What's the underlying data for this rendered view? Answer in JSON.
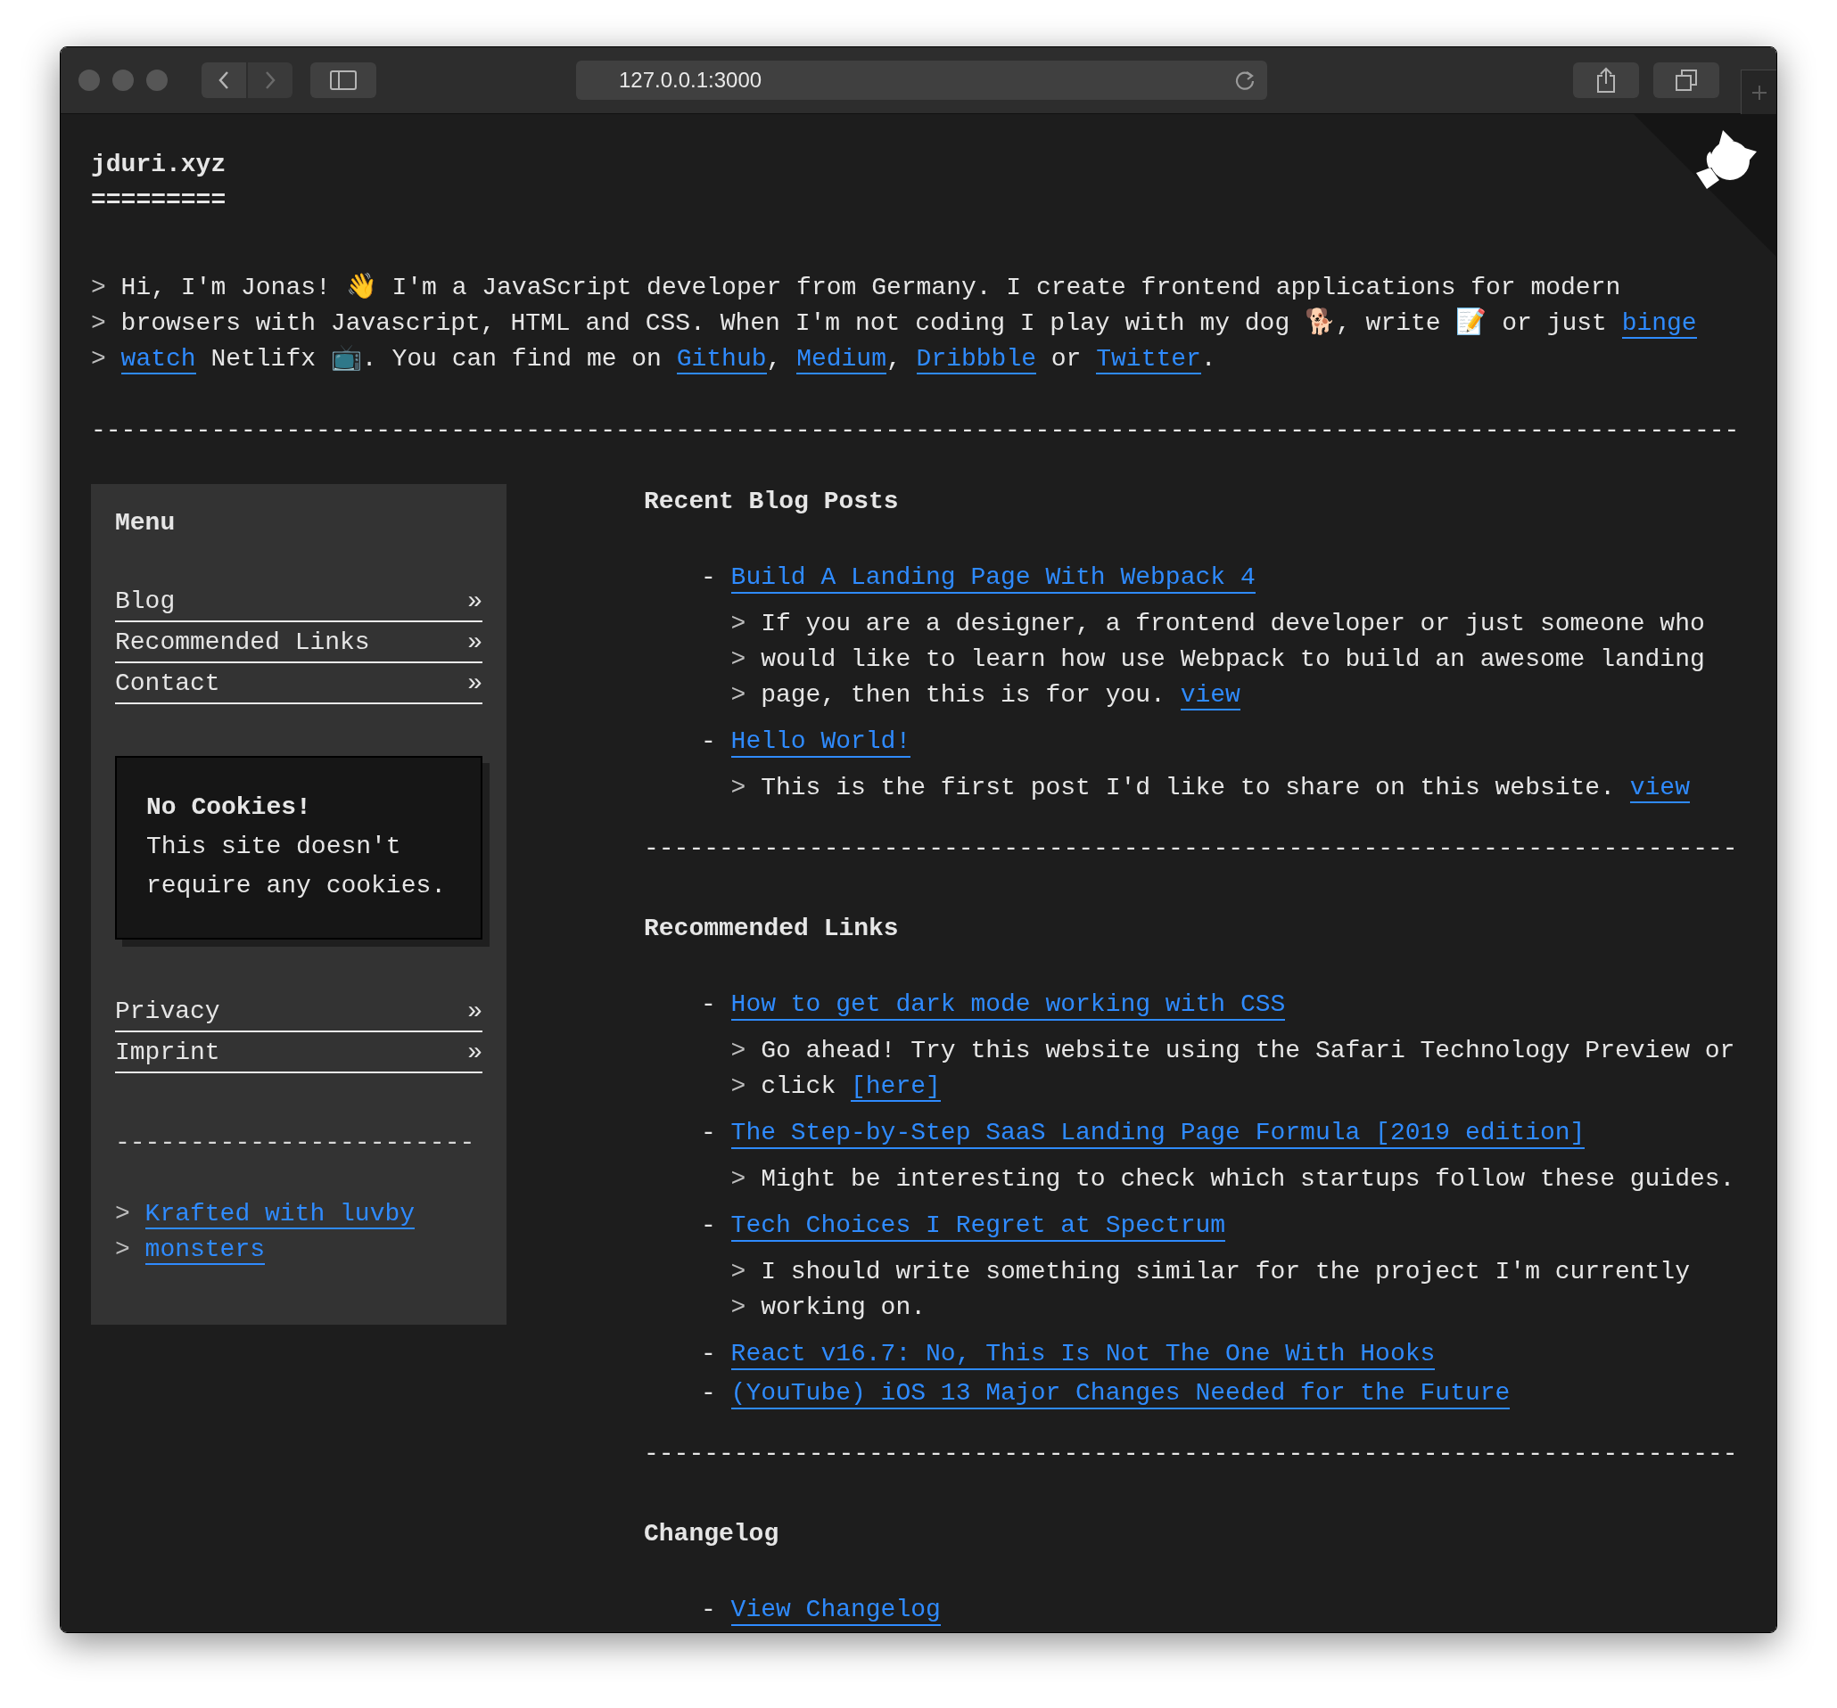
{
  "browser": {
    "url": "127.0.0.1:3000"
  },
  "header": {
    "title": "jduri.xyz",
    "underline": "========="
  },
  "intro": {
    "lines": [
      {
        "prefix": ">",
        "segments": [
          {
            "kind": "text",
            "text": "Hi, I'm Jonas! 👋 I'm a JavaScript developer from Germany. I create frontend applications for modern"
          }
        ]
      },
      {
        "prefix": ">",
        "segments": [
          {
            "kind": "text",
            "text": "browsers with Javascript, HTML and CSS. When I'm not coding I play with my dog 🐕, write 📝 or just "
          },
          {
            "kind": "link",
            "text": "binge"
          }
        ]
      },
      {
        "prefix": ">",
        "segments": [
          {
            "kind": "link",
            "text": "watch"
          },
          {
            "kind": "text",
            "text": " Netlifx 📺. You can find me on "
          },
          {
            "kind": "link",
            "text": "Github"
          },
          {
            "kind": "text",
            "text": ", "
          },
          {
            "kind": "link",
            "text": "Medium"
          },
          {
            "kind": "text",
            "text": ", "
          },
          {
            "kind": "link",
            "text": "Dribbble"
          },
          {
            "kind": "text",
            "text": " or "
          },
          {
            "kind": "link",
            "text": "Twitter"
          },
          {
            "kind": "text",
            "text": "."
          }
        ]
      }
    ],
    "divider": "--------------------------------------------------------------------------------------------------------------"
  },
  "sidebar": {
    "title": "Menu",
    "menu": [
      {
        "label": "Blog",
        "arrow": "»"
      },
      {
        "label": "Recommended Links",
        "arrow": "»"
      },
      {
        "label": "Contact",
        "arrow": "»"
      }
    ],
    "notice": {
      "title": "No Cookies!",
      "text": "This site doesn't require any cookies."
    },
    "legal": [
      {
        "label": "Privacy",
        "arrow": "»"
      },
      {
        "label": "Imprint",
        "arrow": "»"
      }
    ],
    "divider": "------------------------",
    "footer": [
      {
        "prefix": ">",
        "segments": [
          {
            "kind": "link",
            "text": "Krafted with luvby"
          }
        ]
      },
      {
        "prefix": ">",
        "segments": [
          {
            "kind": "link",
            "text": "monsters"
          }
        ]
      }
    ]
  },
  "sections": [
    {
      "title": "Recent Blog Posts",
      "items": [
        {
          "marker": "-",
          "title": "Build A Landing Page With Webpack 4",
          "desc": [
            {
              "prefix": ">",
              "segments": [
                {
                  "kind": "text",
                  "text": "If you are a designer, a frontend developer or just someone who"
                }
              ]
            },
            {
              "prefix": ">",
              "segments": [
                {
                  "kind": "text",
                  "text": "would like to learn how use Webpack to build an awesome landing"
                }
              ]
            },
            {
              "prefix": ">",
              "segments": [
                {
                  "kind": "text",
                  "text": "page, then this is for you. "
                },
                {
                  "kind": "link",
                  "text": "view"
                }
              ]
            }
          ]
        },
        {
          "marker": "-",
          "title": "Hello World!",
          "desc": [
            {
              "prefix": ">",
              "segments": [
                {
                  "kind": "text",
                  "text": "This is the first post I'd like to share on this website. "
                },
                {
                  "kind": "link",
                  "text": "view"
                }
              ]
            }
          ]
        }
      ],
      "divider": "-------------------------------------------------------------------------"
    },
    {
      "title": "Recommended Links",
      "items": [
        {
          "marker": "-",
          "title": "How to get dark mode working with CSS",
          "desc": [
            {
              "prefix": ">",
              "segments": [
                {
                  "kind": "text",
                  "text": "Go ahead! Try this website using the Safari Technology Preview or"
                }
              ]
            },
            {
              "prefix": ">",
              "segments": [
                {
                  "kind": "text",
                  "text": "click "
                },
                {
                  "kind": "link",
                  "text": "[here]"
                }
              ]
            }
          ]
        },
        {
          "marker": "-",
          "title": "The Step-by-Step SaaS Landing Page Formula [2019 edition]",
          "desc": [
            {
              "prefix": ">",
              "segments": [
                {
                  "kind": "text",
                  "text": "Might be interesting to check which startups follow these guides."
                }
              ]
            }
          ]
        },
        {
          "marker": "-",
          "title": "Tech Choices I Regret at Spectrum",
          "desc": [
            {
              "prefix": ">",
              "segments": [
                {
                  "kind": "text",
                  "text": "I should write something similar for the project I'm currently"
                }
              ]
            },
            {
              "prefix": ">",
              "segments": [
                {
                  "kind": "text",
                  "text": "working on."
                }
              ]
            }
          ]
        },
        {
          "marker": "-",
          "title": "React v16.7: No, This Is Not The One With Hooks"
        },
        {
          "marker": "-",
          "title": "(YouTube) iOS 13 Major Changes Needed for the Future"
        }
      ],
      "divider": "-------------------------------------------------------------------------"
    },
    {
      "title": "Changelog",
      "items": [
        {
          "marker": "-",
          "title": "View Changelog"
        }
      ]
    }
  ]
}
